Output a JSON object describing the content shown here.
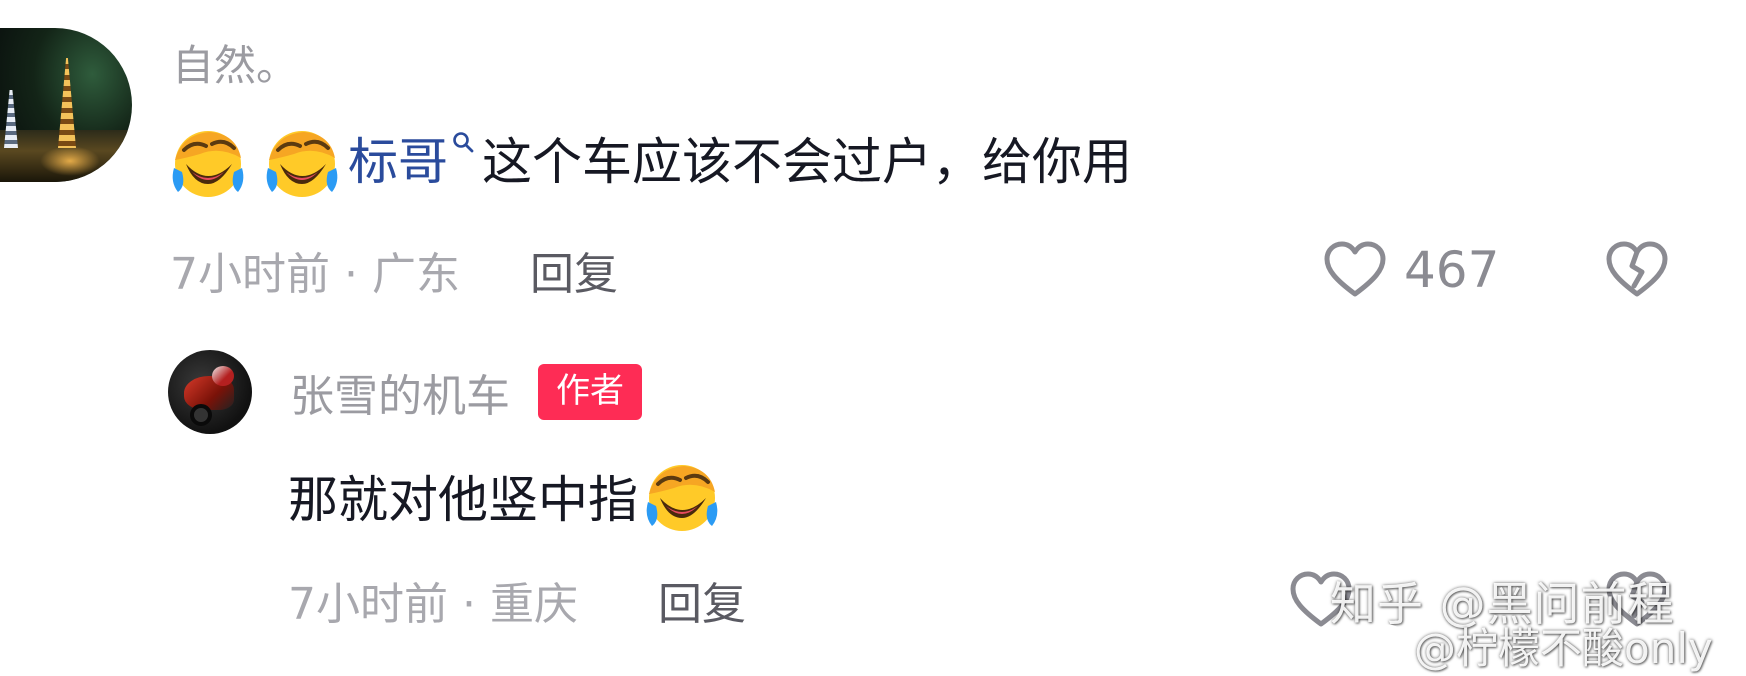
{
  "comment": {
    "username": "自然。",
    "mention": "标哥",
    "text": "这个车应该不会过户，给你用",
    "time_location": "7小时前 · 广东",
    "reply_label": "回复",
    "likes": "467",
    "emoji_icon": "laughing-crying-emoji"
  },
  "reply": {
    "username": "张雪的机车",
    "badge": "作者",
    "text": "那就对他竖中指",
    "time_location": "7小时前 · 重庆",
    "reply_label": "回复"
  },
  "watermarks": {
    "zhihu": "知乎 @黑问前程",
    "weibo": "@柠檬不酸only"
  },
  "colors": {
    "badge": "#fe2c55",
    "mention": "#2a4b9c",
    "meta": "#a8a8ae",
    "username": "#9b9ba1"
  }
}
